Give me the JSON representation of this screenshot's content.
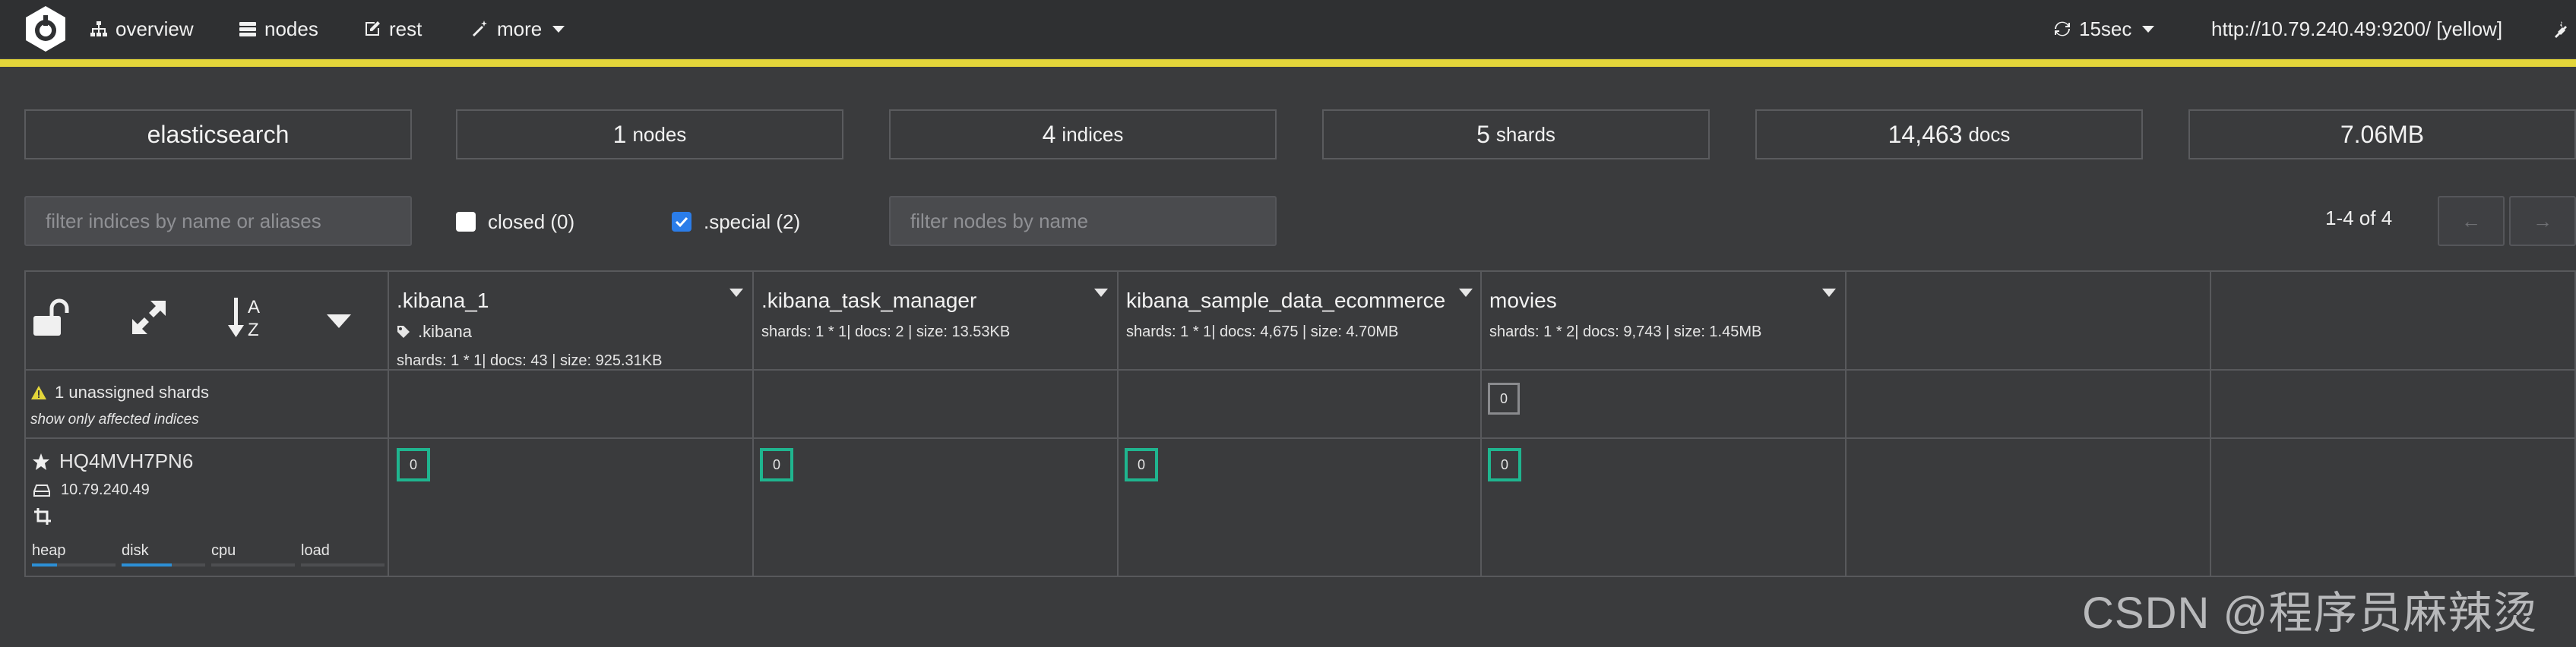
{
  "nav": {
    "overview": "overview",
    "nodes": "nodes",
    "rest": "rest",
    "more": "more",
    "refresh": "15sec",
    "cluster_url": "http://10.79.240.49:9200/ [yellow]",
    "accent_color": "#e3d53a"
  },
  "stats": {
    "cluster_name": "elasticsearch",
    "nodes_value": "1",
    "nodes_unit": "nodes",
    "indices_value": "4",
    "indices_unit": "indices",
    "shards_value": "5",
    "shards_unit": "shards",
    "docs_value": "14,463",
    "docs_unit": "docs",
    "size": "7.06MB"
  },
  "filters": {
    "indices_placeholder": "filter indices by name or aliases",
    "closed_label": "closed (0)",
    "closed_checked": false,
    "special_label": ".special (2)",
    "special_checked": true,
    "nodes_placeholder": "filter nodes by name",
    "pager_text": "1-4 of 4",
    "prev_label": "←",
    "next_label": "→"
  },
  "indices": [
    {
      "name": ".kibana_1",
      "alias": ".kibana",
      "stats": "shards: 1 * 1| docs: 43 | size: 925.31KB",
      "shard": "0"
    },
    {
      "name": ".kibana_task_manager",
      "alias": "",
      "stats": "shards: 1 * 1| docs: 2 | size: 13.53KB",
      "shard": "0"
    },
    {
      "name": "kibana_sample_data_ecommerce",
      "alias": "",
      "stats": "shards: 1 * 1| docs: 4,675 | size: 4.70MB",
      "shard": "0"
    },
    {
      "name": "movies",
      "alias": "",
      "stats": "shards: 1 * 2| docs: 9,743 | size: 1.45MB",
      "shard": "0",
      "unassigned_shard": "0"
    }
  ],
  "unassigned": {
    "text": "1 unassigned shards",
    "link": "show only affected indices",
    "warning_color": "#e3d53a"
  },
  "node": {
    "name": "HQ4MVH7PN6",
    "ip": "10.79.240.49",
    "metrics": {
      "heap_label": "heap",
      "heap_level": 0.3,
      "disk_label": "disk",
      "disk_level": 0.6,
      "cpu_label": "cpu",
      "cpu_level": 0.0,
      "load_label": "load",
      "load_level": 0.0
    },
    "shard_color": "#1fb58f"
  },
  "watermark": "CSDN @程序员麻辣烫"
}
